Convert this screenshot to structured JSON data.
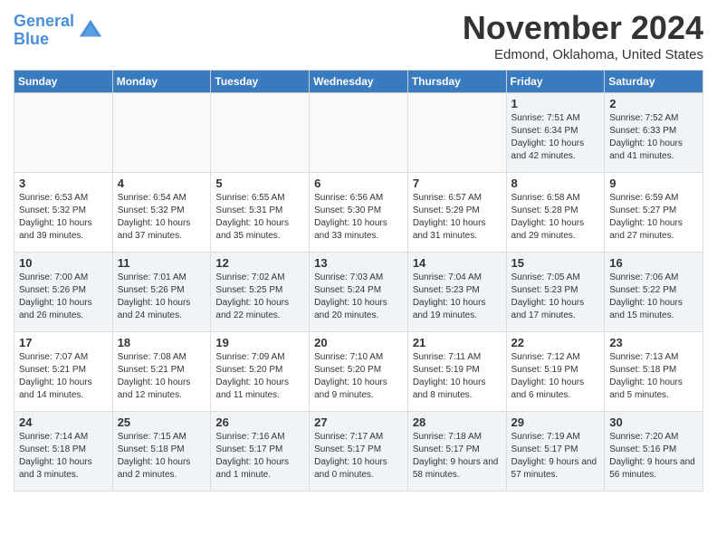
{
  "header": {
    "logo_general": "General",
    "logo_blue": "Blue",
    "month_title": "November 2024",
    "location": "Edmond, Oklahoma, United States"
  },
  "days_of_week": [
    "Sunday",
    "Monday",
    "Tuesday",
    "Wednesday",
    "Thursday",
    "Friday",
    "Saturday"
  ],
  "weeks": [
    [
      {
        "day": "",
        "content": "",
        "empty": true
      },
      {
        "day": "",
        "content": "",
        "empty": true
      },
      {
        "day": "",
        "content": "",
        "empty": true
      },
      {
        "day": "",
        "content": "",
        "empty": true
      },
      {
        "day": "",
        "content": "",
        "empty": true
      },
      {
        "day": "1",
        "content": "Sunrise: 7:51 AM\nSunset: 6:34 PM\nDaylight: 10 hours and 42 minutes.",
        "empty": false
      },
      {
        "day": "2",
        "content": "Sunrise: 7:52 AM\nSunset: 6:33 PM\nDaylight: 10 hours and 41 minutes.",
        "empty": false
      }
    ],
    [
      {
        "day": "3",
        "content": "Sunrise: 6:53 AM\nSunset: 5:32 PM\nDaylight: 10 hours and 39 minutes.",
        "empty": false
      },
      {
        "day": "4",
        "content": "Sunrise: 6:54 AM\nSunset: 5:32 PM\nDaylight: 10 hours and 37 minutes.",
        "empty": false
      },
      {
        "day": "5",
        "content": "Sunrise: 6:55 AM\nSunset: 5:31 PM\nDaylight: 10 hours and 35 minutes.",
        "empty": false
      },
      {
        "day": "6",
        "content": "Sunrise: 6:56 AM\nSunset: 5:30 PM\nDaylight: 10 hours and 33 minutes.",
        "empty": false
      },
      {
        "day": "7",
        "content": "Sunrise: 6:57 AM\nSunset: 5:29 PM\nDaylight: 10 hours and 31 minutes.",
        "empty": false
      },
      {
        "day": "8",
        "content": "Sunrise: 6:58 AM\nSunset: 5:28 PM\nDaylight: 10 hours and 29 minutes.",
        "empty": false
      },
      {
        "day": "9",
        "content": "Sunrise: 6:59 AM\nSunset: 5:27 PM\nDaylight: 10 hours and 27 minutes.",
        "empty": false
      }
    ],
    [
      {
        "day": "10",
        "content": "Sunrise: 7:00 AM\nSunset: 5:26 PM\nDaylight: 10 hours and 26 minutes.",
        "empty": false
      },
      {
        "day": "11",
        "content": "Sunrise: 7:01 AM\nSunset: 5:26 PM\nDaylight: 10 hours and 24 minutes.",
        "empty": false
      },
      {
        "day": "12",
        "content": "Sunrise: 7:02 AM\nSunset: 5:25 PM\nDaylight: 10 hours and 22 minutes.",
        "empty": false
      },
      {
        "day": "13",
        "content": "Sunrise: 7:03 AM\nSunset: 5:24 PM\nDaylight: 10 hours and 20 minutes.",
        "empty": false
      },
      {
        "day": "14",
        "content": "Sunrise: 7:04 AM\nSunset: 5:23 PM\nDaylight: 10 hours and 19 minutes.",
        "empty": false
      },
      {
        "day": "15",
        "content": "Sunrise: 7:05 AM\nSunset: 5:23 PM\nDaylight: 10 hours and 17 minutes.",
        "empty": false
      },
      {
        "day": "16",
        "content": "Sunrise: 7:06 AM\nSunset: 5:22 PM\nDaylight: 10 hours and 15 minutes.",
        "empty": false
      }
    ],
    [
      {
        "day": "17",
        "content": "Sunrise: 7:07 AM\nSunset: 5:21 PM\nDaylight: 10 hours and 14 minutes.",
        "empty": false
      },
      {
        "day": "18",
        "content": "Sunrise: 7:08 AM\nSunset: 5:21 PM\nDaylight: 10 hours and 12 minutes.",
        "empty": false
      },
      {
        "day": "19",
        "content": "Sunrise: 7:09 AM\nSunset: 5:20 PM\nDaylight: 10 hours and 11 minutes.",
        "empty": false
      },
      {
        "day": "20",
        "content": "Sunrise: 7:10 AM\nSunset: 5:20 PM\nDaylight: 10 hours and 9 minutes.",
        "empty": false
      },
      {
        "day": "21",
        "content": "Sunrise: 7:11 AM\nSunset: 5:19 PM\nDaylight: 10 hours and 8 minutes.",
        "empty": false
      },
      {
        "day": "22",
        "content": "Sunrise: 7:12 AM\nSunset: 5:19 PM\nDaylight: 10 hours and 6 minutes.",
        "empty": false
      },
      {
        "day": "23",
        "content": "Sunrise: 7:13 AM\nSunset: 5:18 PM\nDaylight: 10 hours and 5 minutes.",
        "empty": false
      }
    ],
    [
      {
        "day": "24",
        "content": "Sunrise: 7:14 AM\nSunset: 5:18 PM\nDaylight: 10 hours and 3 minutes.",
        "empty": false
      },
      {
        "day": "25",
        "content": "Sunrise: 7:15 AM\nSunset: 5:18 PM\nDaylight: 10 hours and 2 minutes.",
        "empty": false
      },
      {
        "day": "26",
        "content": "Sunrise: 7:16 AM\nSunset: 5:17 PM\nDaylight: 10 hours and 1 minute.",
        "empty": false
      },
      {
        "day": "27",
        "content": "Sunrise: 7:17 AM\nSunset: 5:17 PM\nDaylight: 10 hours and 0 minutes.",
        "empty": false
      },
      {
        "day": "28",
        "content": "Sunrise: 7:18 AM\nSunset: 5:17 PM\nDaylight: 9 hours and 58 minutes.",
        "empty": false
      },
      {
        "day": "29",
        "content": "Sunrise: 7:19 AM\nSunset: 5:17 PM\nDaylight: 9 hours and 57 minutes.",
        "empty": false
      },
      {
        "day": "30",
        "content": "Sunrise: 7:20 AM\nSunset: 5:16 PM\nDaylight: 9 hours and 56 minutes.",
        "empty": false
      }
    ]
  ]
}
